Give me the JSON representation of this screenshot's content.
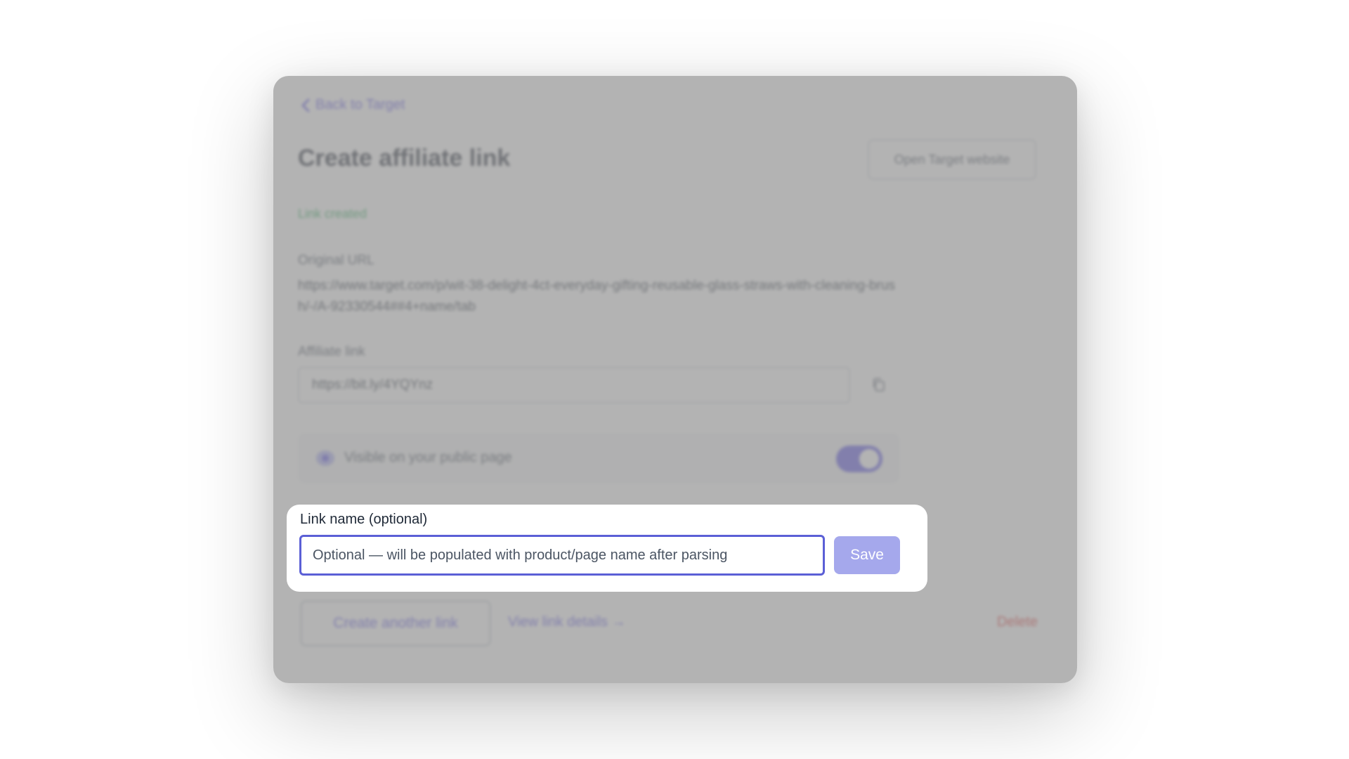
{
  "back_link": {
    "label": "Back to Target"
  },
  "header": {
    "title": "Create affiliate link",
    "open_site_label": "Open Target website"
  },
  "status": {
    "text": "Link created"
  },
  "original_url": {
    "label": "Original URL",
    "value": "https://www.target.com/p/wit-38-delight-4ct-everyday-gifting-reusable-glass-straws-with-cleaning-brush/-/A-92330544##4+name/tab"
  },
  "affiliate_link": {
    "label": "Affiliate link",
    "value": "https://bit.ly/4YQYnz"
  },
  "visibility": {
    "label": "Visible on your public page",
    "enabled": true
  },
  "link_name": {
    "label": "Link name (optional)",
    "placeholder": "Optional — will be populated with product/page name after parsing",
    "value": "",
    "save_label": "Save"
  },
  "footer": {
    "create_another_label": "Create another link",
    "view_details_label": "View link details →",
    "delete_label": "Delete"
  },
  "colors": {
    "accent": "#4f46e5",
    "success": "#16a34a",
    "danger": "#dc2626",
    "save_disabled": "#a5a8ec"
  }
}
